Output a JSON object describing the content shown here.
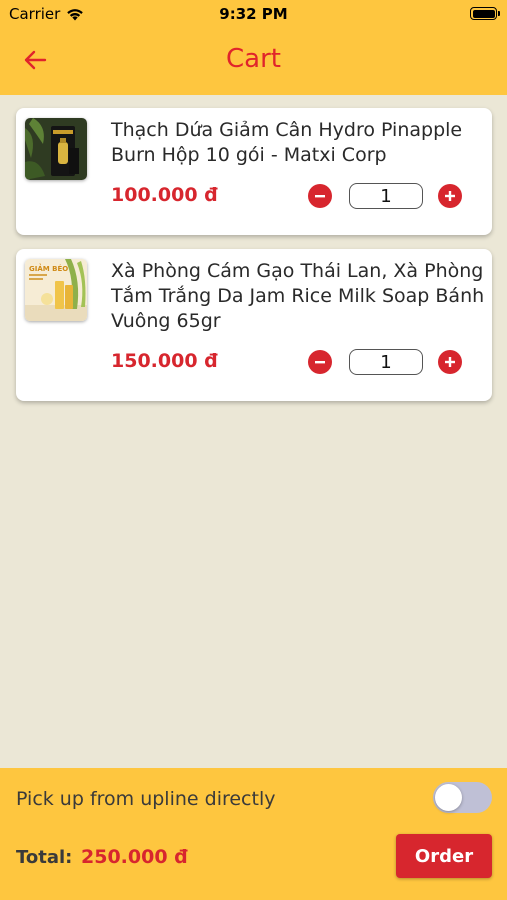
{
  "status_bar": {
    "carrier": "Carrier",
    "time": "9:32 PM"
  },
  "header": {
    "title": "Cart",
    "back_icon": "arrow-left-icon"
  },
  "cart": {
    "items": [
      {
        "name": "Thạch Dứa Giảm Cân Hydro Pinapple Burn Hộp 10 gói - Matxi Corp",
        "price": "100.000 đ",
        "quantity": "1"
      },
      {
        "name": "Xà Phòng Cám Gạo Thái Lan, Xà Phòng Tắm Trắng Da Jam Rice Milk Soap Bánh Vuông 65gr",
        "price": "150.000 đ",
        "quantity": "1",
        "thumb_text": "GIẢM BÉO"
      }
    ]
  },
  "footer": {
    "pickup_label": "Pick up from upline directly",
    "pickup_enabled": false,
    "total_label": "Total:",
    "total_value": "250.000 đ",
    "order_label": "Order"
  },
  "colors": {
    "header_bg": "#fec63f",
    "page_bg": "#ebe7d6",
    "accent_red": "#d7262e",
    "toggle_off": "#bfc0d6"
  }
}
